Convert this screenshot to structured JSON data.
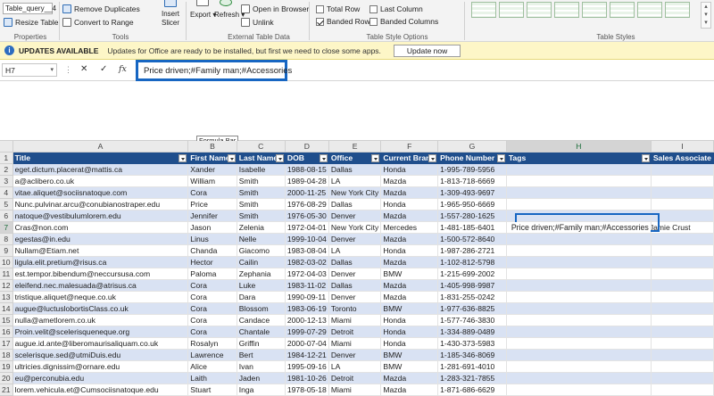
{
  "ribbon": {
    "table_name": "Table_query__4",
    "resize_table": "Resize Table",
    "properties_label": "Properties",
    "remove_duplicates": "Remove Duplicates",
    "convert_to_range": "Convert to Range",
    "tools_label": "Tools",
    "insert_slicer_1": "Insert",
    "insert_slicer_2": "Slicer",
    "export": "Export",
    "refresh": "Refresh",
    "open_in_browser": "Open in Browser",
    "unlink": "Unlink",
    "external_label": "External Table Data",
    "total_row": "Total Row",
    "banded_rows": "Banded Rows",
    "last_column": "Last Column",
    "banded_columns": "Banded Columns",
    "style_options_label": "Table Style Options",
    "table_styles_label": "Table Styles",
    "total_row_checked": false,
    "banded_rows_checked": true,
    "last_column_checked": false,
    "banded_columns_checked": false
  },
  "update_bar": {
    "title": "UPDATES AVAILABLE",
    "message": "Updates for Office are ready to be installed, but first we need to close some apps.",
    "button": "Update now"
  },
  "formula": {
    "name_box": "H7",
    "cancel": "✕",
    "enter": "✓",
    "fx": "fx",
    "content": "Price driven;#Family man;#Accessories",
    "tooltip": "Formula Bar"
  },
  "columns": [
    "A",
    "B",
    "C",
    "D",
    "E",
    "F",
    "G",
    "H",
    "I"
  ],
  "selected_column": "H",
  "selected_row": "7",
  "headers": [
    "Title",
    "First Name",
    "Last Name",
    "DOB",
    "Office",
    "Current Brand",
    "Phone Number",
    "Tags",
    "Sales Associate"
  ],
  "rows": [
    {
      "n": "2",
      "cells": [
        "eget.dictum.placerat@mattis.ca",
        "Xander",
        "Isabelle",
        "1988-08-15",
        "Dallas",
        "Honda",
        "1-995-789-5956",
        "",
        ""
      ]
    },
    {
      "n": "3",
      "cells": [
        "a@aclibero.co.uk",
        "William",
        "Smith",
        "1989-04-28",
        "LA",
        "Mazda",
        "1-813-718-6669",
        "",
        ""
      ]
    },
    {
      "n": "4",
      "cells": [
        "vitae.aliquet@sociisnatoque.com",
        "Cora",
        "Smith",
        "2000-11-25",
        "New York City",
        "Mazda",
        "1-309-493-9697",
        "",
        ""
      ]
    },
    {
      "n": "5",
      "cells": [
        "Nunc.pulvinar.arcu@conubianostraper.edu",
        "Price",
        "Smith",
        "1976-08-29",
        "Dallas",
        "Honda",
        "1-965-950-6669",
        "",
        ""
      ]
    },
    {
      "n": "6",
      "cells": [
        "natoque@vestibulumlorem.edu",
        "Jennifer",
        "Smith",
        "1976-05-30",
        "Denver",
        "Mazda",
        "1-557-280-1625",
        "",
        ""
      ]
    },
    {
      "n": "7",
      "cells": [
        "Cras@non.com",
        "Jason",
        "Zelenia",
        "1972-04-01",
        "New York City",
        "Mercedes",
        "1-481-185-6401",
        "Price driven;#Family man;#Accessories",
        "Jamie Crust"
      ]
    },
    {
      "n": "8",
      "cells": [
        "egestas@in.edu",
        "Linus",
        "Nelle",
        "1999-10-04",
        "Denver",
        "Mazda",
        "1-500-572-8640",
        "",
        ""
      ]
    },
    {
      "n": "9",
      "cells": [
        "Nullam@Etiam.net",
        "Chanda",
        "Giacomo",
        "1983-08-04",
        "LA",
        "Honda",
        "1-987-286-2721",
        "",
        ""
      ]
    },
    {
      "n": "10",
      "cells": [
        "ligula.elit.pretium@risus.ca",
        "Hector",
        "Cailin",
        "1982-03-02",
        "Dallas",
        "Mazda",
        "1-102-812-5798",
        "",
        ""
      ]
    },
    {
      "n": "11",
      "cells": [
        "est.tempor.bibendum@neccursusa.com",
        "Paloma",
        "Zephania",
        "1972-04-03",
        "Denver",
        "BMW",
        "1-215-699-2002",
        "",
        ""
      ]
    },
    {
      "n": "12",
      "cells": [
        "eleifend.nec.malesuada@atrisus.ca",
        "Cora",
        "Luke",
        "1983-11-02",
        "Dallas",
        "Mazda",
        "1-405-998-9987",
        "",
        ""
      ]
    },
    {
      "n": "13",
      "cells": [
        "tristique.aliquet@neque.co.uk",
        "Cora",
        "Dara",
        "1990-09-11",
        "Denver",
        "Mazda",
        "1-831-255-0242",
        "",
        ""
      ]
    },
    {
      "n": "14",
      "cells": [
        "augue@luctuslobortisClass.co.uk",
        "Cora",
        "Blossom",
        "1983-06-19",
        "Toronto",
        "BMW",
        "1-977-636-8825",
        "",
        ""
      ]
    },
    {
      "n": "15",
      "cells": [
        "nulla@ametlorem.co.uk",
        "Cora",
        "Candace",
        "2000-12-13",
        "Miami",
        "Honda",
        "1-577-746-3830",
        "",
        ""
      ]
    },
    {
      "n": "16",
      "cells": [
        "Proin.velit@scelerisqueneque.org",
        "Cora",
        "Chantale",
        "1999-07-29",
        "Detroit",
        "Honda",
        "1-334-889-0489",
        "",
        ""
      ]
    },
    {
      "n": "17",
      "cells": [
        "augue.id.ante@liberomaurisaliquam.co.uk",
        "Rosalyn",
        "Griffin",
        "2000-07-04",
        "Miami",
        "Honda",
        "1-430-373-5983",
        "",
        ""
      ]
    },
    {
      "n": "18",
      "cells": [
        "scelerisque.sed@utmiDuis.edu",
        "Lawrence",
        "Bert",
        "1984-12-21",
        "Denver",
        "BMW",
        "1-185-346-8069",
        "",
        ""
      ]
    },
    {
      "n": "19",
      "cells": [
        "ultricies.dignissim@ornare.edu",
        "Alice",
        "Ivan",
        "1995-09-16",
        "LA",
        "BMW",
        "1-281-691-4010",
        "",
        ""
      ]
    },
    {
      "n": "20",
      "cells": [
        "eu@perconubia.edu",
        "Laith",
        "Jaden",
        "1981-10-26",
        "Detroit",
        "Mazda",
        "1-283-321-7855",
        "",
        ""
      ]
    },
    {
      "n": "21",
      "cells": [
        "lorem.vehicula.et@Cumsociisnatoque.edu",
        "Stuart",
        "Inga",
        "1978-05-18",
        "Miami",
        "Mazda",
        "1-871-686-6629",
        "",
        ""
      ]
    }
  ]
}
